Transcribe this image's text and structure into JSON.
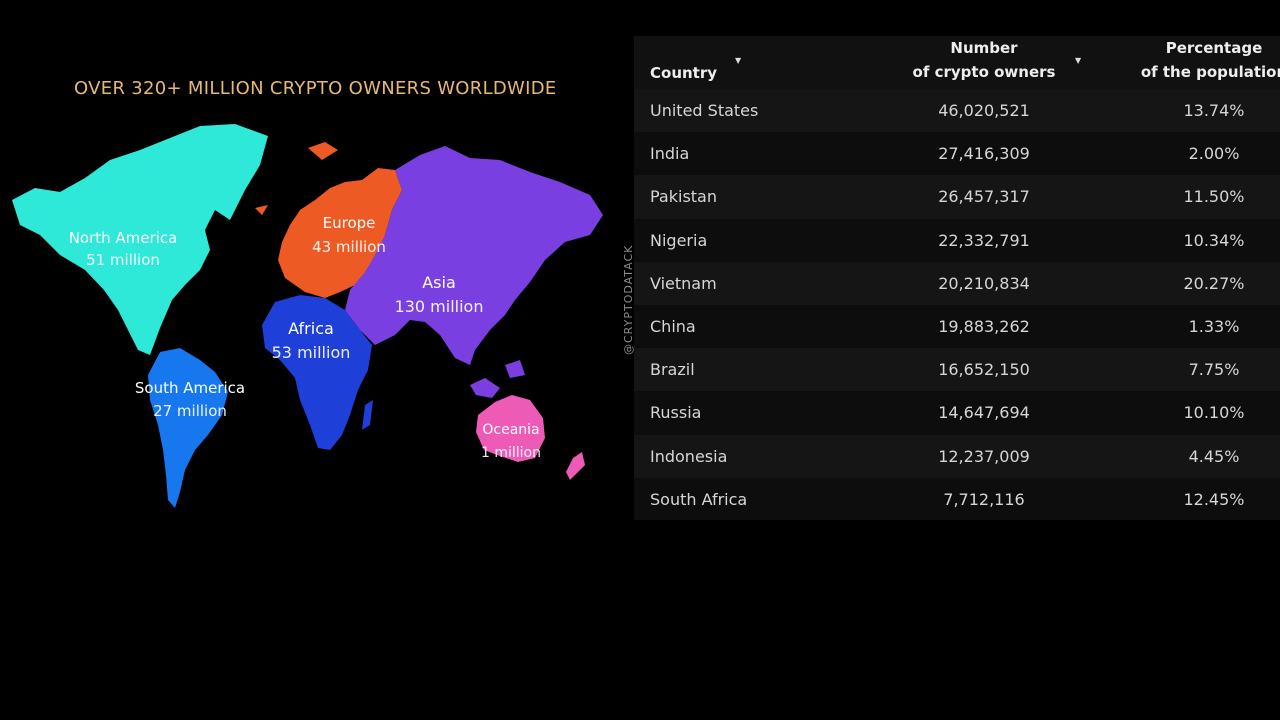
{
  "title": "OVER 320+ MILLION CRYPTO OWNERS WORLDWIDE",
  "watermark": "@CRYPTODATACK",
  "regions": [
    {
      "name": "North America",
      "value": "51 million",
      "color": "#2ee8d8"
    },
    {
      "name": "Europe",
      "value": "43 million",
      "color": "#ee5a24"
    },
    {
      "name": "Asia",
      "value": "130 million",
      "color": "#7a3fe0"
    },
    {
      "name": "Africa",
      "value": "53 million",
      "color": "#1e3fd8"
    },
    {
      "name": "South America",
      "value": "27 million",
      "color": "#1677ee"
    },
    {
      "name": "Oceania",
      "value": "1 million",
      "color": "#ee5bb7"
    }
  ],
  "table": {
    "headers": {
      "country": "Country",
      "number_line1": "Number",
      "number_line2": "of crypto owners",
      "pct_line1": "Percentage",
      "pct_line2": "of the population"
    },
    "rows": [
      {
        "country": "United States",
        "number": "46,020,521",
        "pct": "13.74%"
      },
      {
        "country": "India",
        "number": "27,416,309",
        "pct": "2.00%"
      },
      {
        "country": "Pakistan",
        "number": "26,457,317",
        "pct": "11.50%"
      },
      {
        "country": "Nigeria",
        "number": "22,332,791",
        "pct": "10.34%"
      },
      {
        "country": "Vietnam",
        "number": "20,210,834",
        "pct": "20.27%"
      },
      {
        "country": "China",
        "number": "19,883,262",
        "pct": "1.33%"
      },
      {
        "country": "Brazil",
        "number": "16,652,150",
        "pct": "7.75%"
      },
      {
        "country": "Russia",
        "number": "14,647,694",
        "pct": "10.10%"
      },
      {
        "country": "Indonesia",
        "number": "12,237,009",
        "pct": "4.45%"
      },
      {
        "country": "South Africa",
        "number": "7,712,116",
        "pct": "12.45%"
      }
    ]
  }
}
